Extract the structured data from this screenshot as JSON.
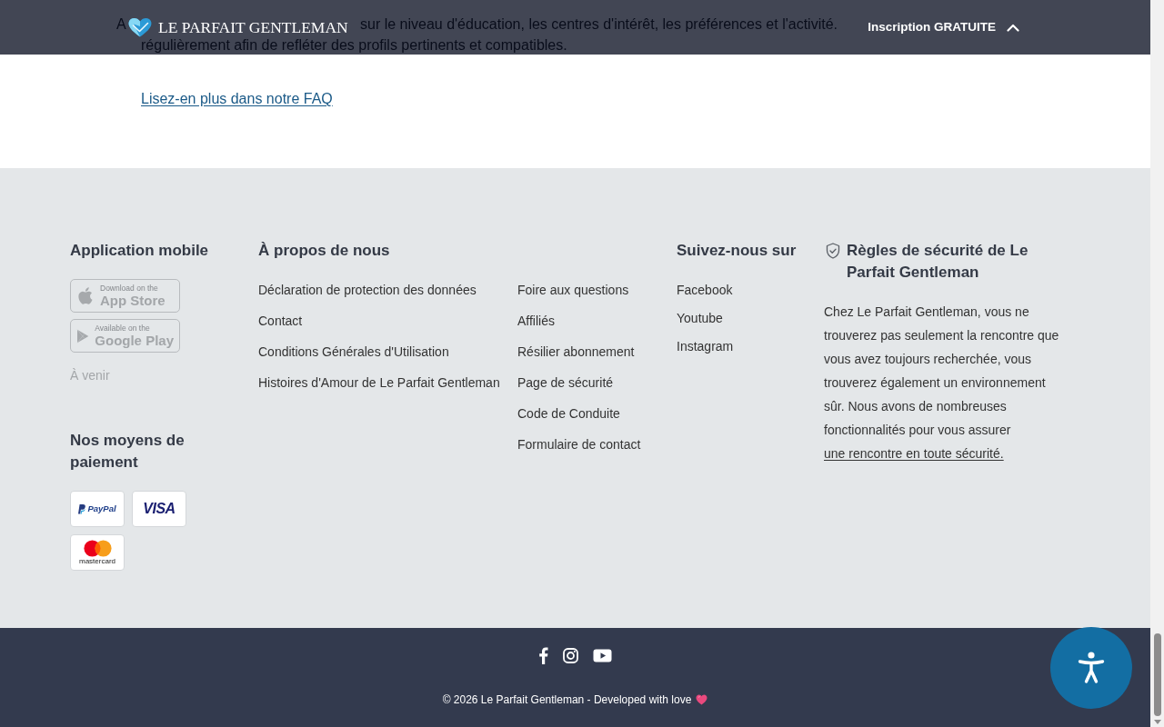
{
  "header": {
    "logo_text": "LE PARFAIT GENTLEMAN",
    "signup_label": "Inscription GRATUITE"
  },
  "faq": {
    "answer_marker": "A",
    "answer_lines": [
      "sur le niveau d'éducation, les centres d'intérêt, les préférences et l'activité.",
      "régulièrement afin de refléter des profils pertinents et compatibles."
    ],
    "more_link": "Lisez-en plus dans notre FAQ"
  },
  "footer": {
    "app": {
      "title": "Application mobile",
      "badges": [
        {
          "kind": "apple",
          "small": "Download on the",
          "large": "App Store",
          "disabled": true
        },
        {
          "kind": "google_play",
          "small": "Available on the",
          "large": "Google Play",
          "disabled": true
        }
      ],
      "note": "À venir"
    },
    "payment": {
      "title": "Nos moyens de paiement",
      "methods": [
        {
          "kind": "paypal",
          "label": "PayPal"
        },
        {
          "kind": "visa",
          "label": "VISA"
        },
        {
          "kind": "mastercard",
          "label": "mastercard"
        }
      ]
    },
    "about": {
      "title": "À propos de nous",
      "link_columns": [
        [
          "Déclaration de protection des données",
          "Contact",
          "Conditions Générales d'Utilisation",
          "Histoires d'Amour de Le Parfait Gentleman"
        ],
        [
          "Foire aux questions",
          "Affiliés",
          "Résilier abonnement",
          "Page de sécurité",
          "Code de Conduite",
          "Formulaire de contact"
        ]
      ]
    },
    "follow": {
      "title": "Suivez-nous sur",
      "links": [
        "Facebook",
        "Youtube",
        "Instagram"
      ]
    },
    "safety": {
      "title": "Règles de sécurité de Le Parfait Gentleman",
      "text": "Chez Le Parfait Gentleman, vous ne trouverez pas seulement la rencontre que vous avez toujours recherchée, vous trouverez également un environnement sûr. Nous avons de nombreuses fonctionnalités pour vous assurer",
      "link": "une rencontre en toute sécurité."
    }
  },
  "bottom_bar": {
    "social_icons": [
      {
        "kind": "facebook"
      },
      {
        "kind": "instagram"
      },
      {
        "kind": "youtube"
      }
    ],
    "copyright": "© 2026 Le Parfait Gentleman - Developed with love"
  }
}
